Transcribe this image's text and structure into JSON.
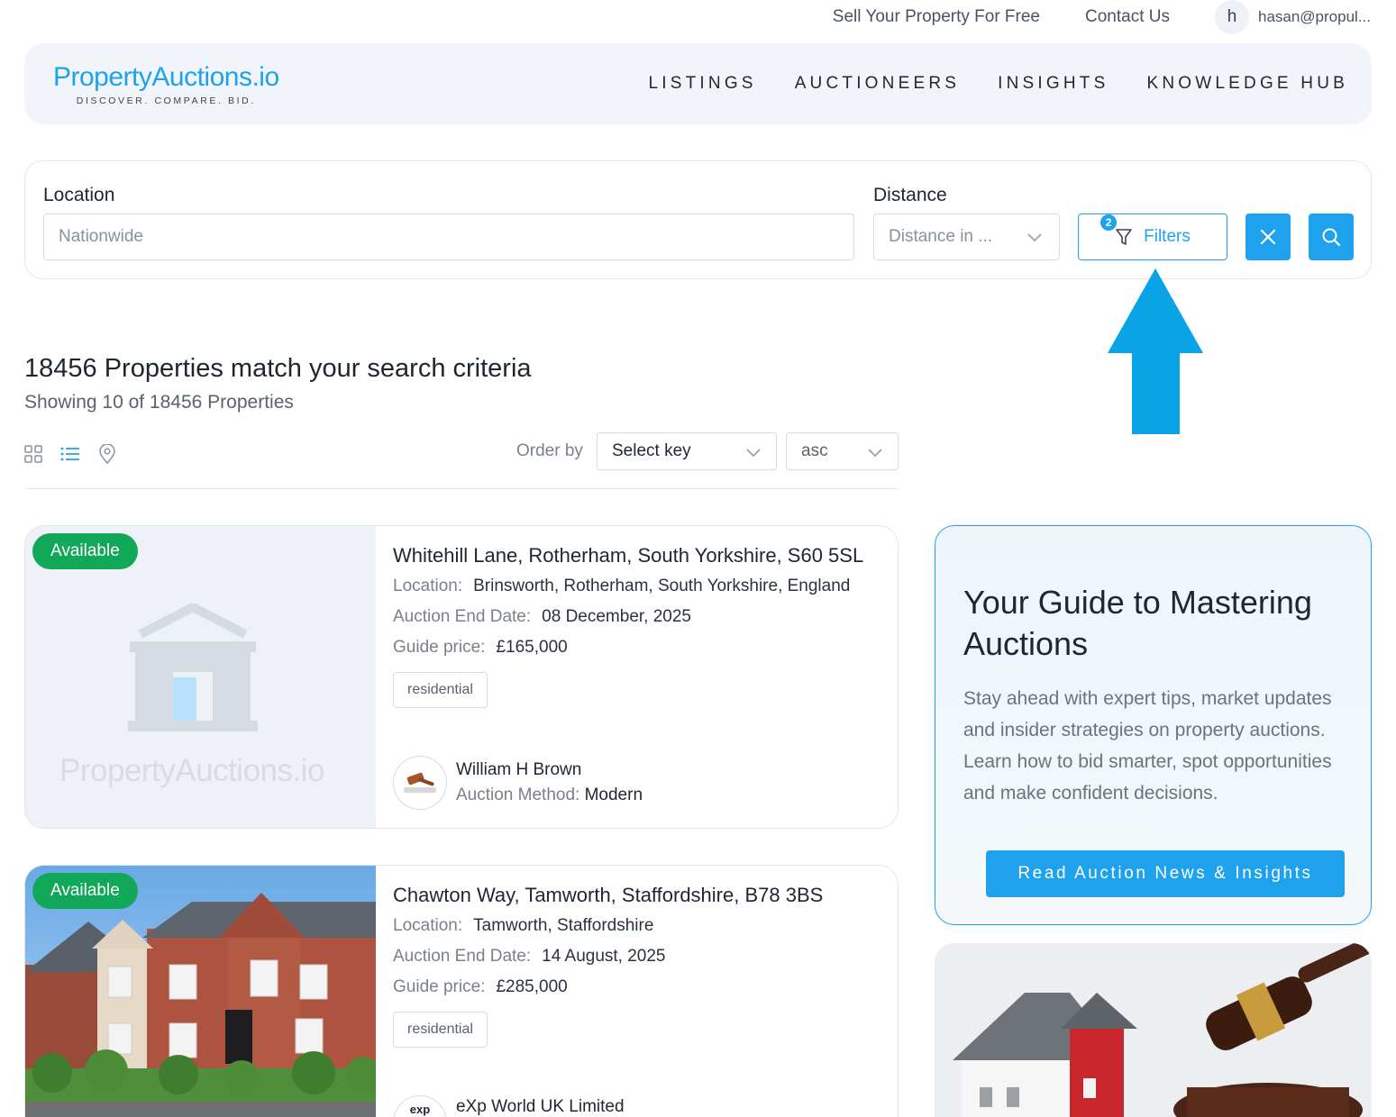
{
  "topbar": {
    "sell_link": "Sell Your Property For Free",
    "contact_link": "Contact Us",
    "avatar_initial": "h",
    "user_email": "hasan@propul..."
  },
  "header": {
    "logo_text": "PropertyAuctions.io",
    "logo_tagline": "DISCOVER. COMPARE. BID.",
    "nav": [
      "LISTINGS",
      "AUCTIONEERS",
      "INSIGHTS",
      "KNOWLEDGE HUB"
    ]
  },
  "search": {
    "location_label": "Location",
    "location_placeholder": "Nationwide",
    "distance_label": "Distance",
    "distance_placeholder": "Distance in ...",
    "filters_label": "Filters",
    "filters_count": "2"
  },
  "results": {
    "title": "18456 Properties match your search criteria",
    "subtitle": "Showing 10 of 18456 Properties",
    "order_by_label": "Order by",
    "order_key": "Select key",
    "order_dir": "asc"
  },
  "listings": [
    {
      "status": "Available",
      "title": "Whitehill Lane, Rotherham, South Yorkshire, S60 5SL",
      "location_label": "Location:",
      "location": "Brinsworth, Rotherham, South Yorkshire, England",
      "end_label": "Auction End Date:",
      "end_date": "08 December, 2025",
      "price_label": "Guide price:",
      "price": "£165,000",
      "tag": "residential",
      "placeholder_text": "PropertyAuctions.io",
      "agent": "William H Brown",
      "method_label": "Auction Method:",
      "method": "Modern"
    },
    {
      "status": "Available",
      "title": "Chawton Way, Tamworth, Staffordshire, B78 3BS",
      "location_label": "Location:",
      "location": "Tamworth, Staffordshire",
      "end_label": "Auction End Date:",
      "end_date": "14 August, 2025",
      "price_label": "Guide price:",
      "price": "£285,000",
      "tag": "residential",
      "agent": "eXp World UK Limited",
      "agent_logo_text": "exp"
    }
  ],
  "guide": {
    "title": "Your Guide to Mastering Auctions",
    "body": "Stay ahead with expert tips, market updates and insider strategies on property auctions. Learn how to bid smarter, spot opportunities and make confident decisions.",
    "button": "Read Auction News & Insights"
  },
  "colors": {
    "accent": "#1ea2ee",
    "available": "#12a85a",
    "annotation_arrow": "#0aa3e6"
  }
}
